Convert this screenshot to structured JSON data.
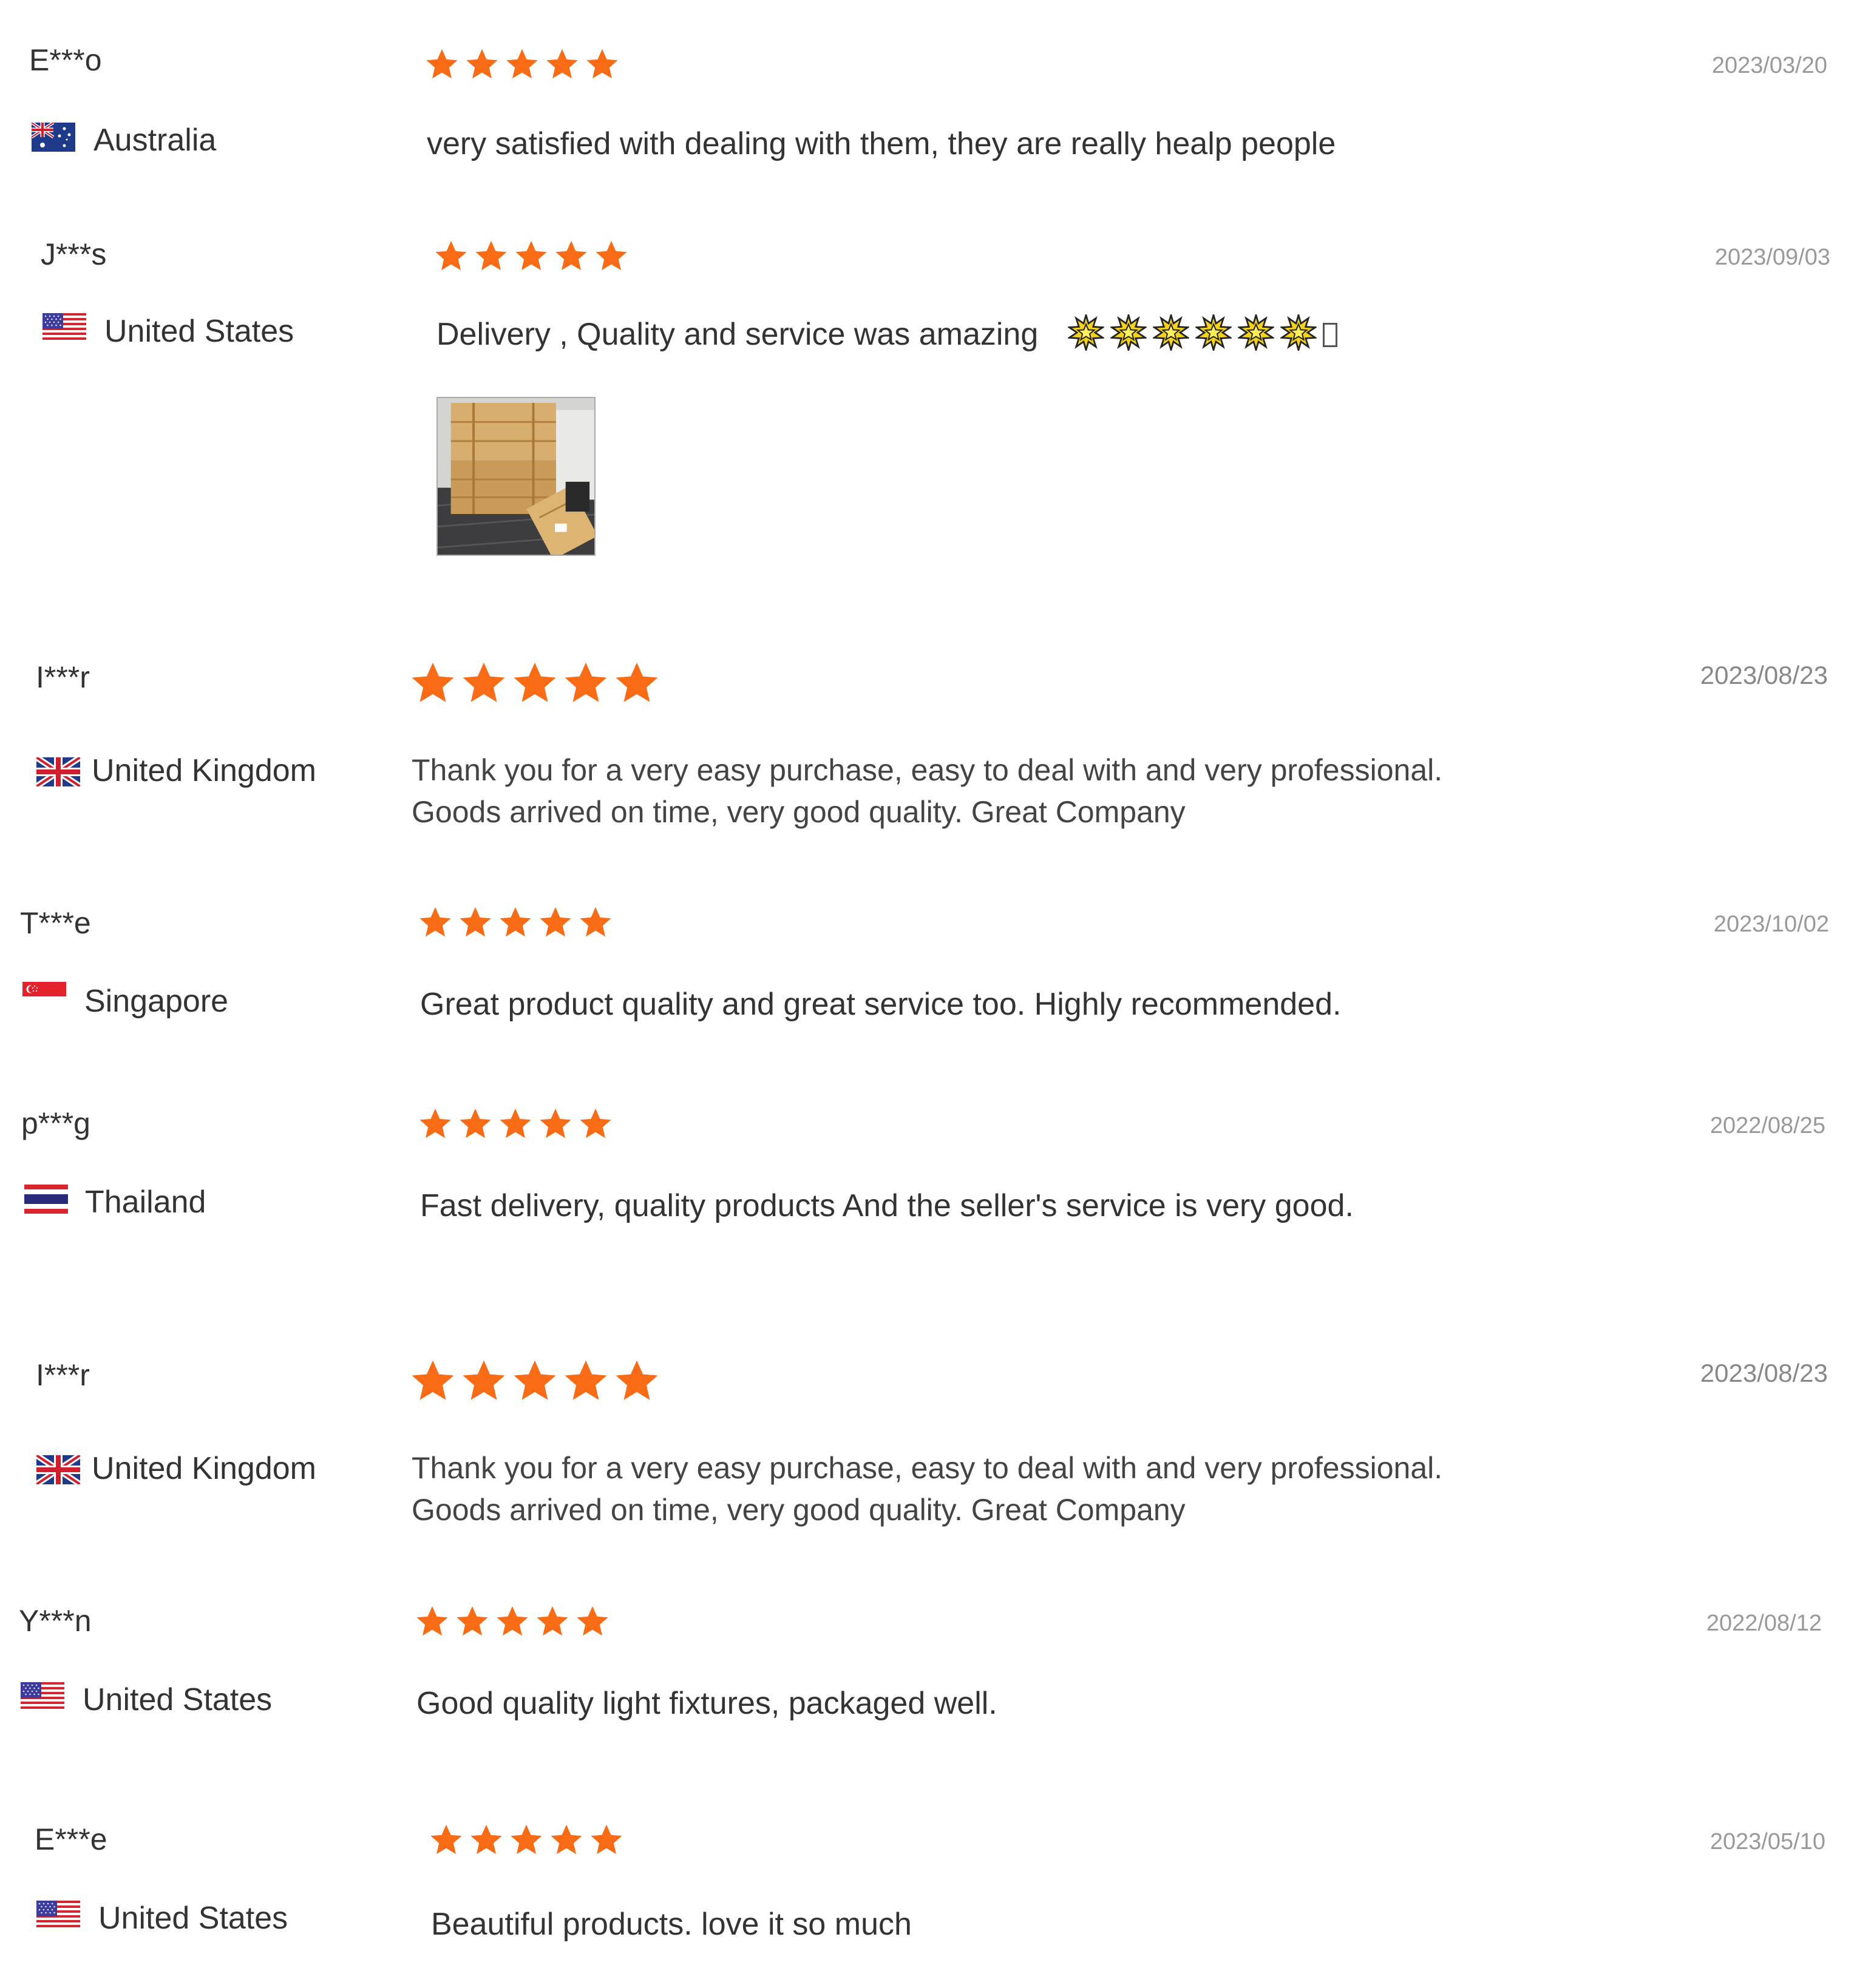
{
  "colors": {
    "star": "#f96b14",
    "name": "#333333",
    "date": "#999999"
  },
  "reviews": [
    {
      "name": "E***o",
      "country": "Australia",
      "flag": "flag-australia-icon",
      "rating": 5,
      "date": "2023/03/20",
      "comment": "very satisfied with dealing with them, they are really healp people"
    },
    {
      "name": "J***s",
      "country": "United States",
      "flag": "flag-united-states-icon",
      "rating": 5,
      "date": "2023/09/03",
      "comment": "Delivery , Quality and service was amazing",
      "comment_emoji": "glowing-star-icon x6",
      "has_photo": true,
      "photo": "wooden-crates-photo"
    },
    {
      "name": "I***r",
      "country": "United Kingdom",
      "flag": "flag-united-kingdom-icon",
      "rating": 5,
      "date": "2023/08/23",
      "comment_line1": "Thank you for a very easy purchase, easy to deal with and very professional.",
      "comment_line2": "Goods arrived on time, very good quality. Great Company"
    },
    {
      "name": "T***e",
      "country": "Singapore",
      "flag": "flag-singapore-icon",
      "rating": 5,
      "date": "2023/10/02",
      "comment": "Great product quality and great service too. Highly recommended."
    },
    {
      "name": "p***g",
      "country": "Thailand",
      "flag": "flag-thailand-icon",
      "rating": 5,
      "date": "2022/08/25",
      "comment": "Fast delivery, quality products And the seller's service is very good."
    },
    {
      "name": "I***r",
      "country": "United Kingdom",
      "flag": "flag-united-kingdom-icon",
      "rating": 5,
      "date": "2023/08/23",
      "comment_line1": "Thank you for a very easy purchase, easy to deal with and very professional.",
      "comment_line2": "Goods arrived on time, very good quality. Great Company"
    },
    {
      "name": "Y***n",
      "country": "United States",
      "flag": "flag-united-states-icon",
      "rating": 5,
      "date": "2022/08/12",
      "comment": "Good quality light fixtures, packaged well."
    },
    {
      "name": "E***e",
      "country": "United States",
      "flag": "flag-united-states-icon",
      "rating": 5,
      "date": "2023/05/10",
      "comment": "Beautiful products. love it so much"
    }
  ]
}
